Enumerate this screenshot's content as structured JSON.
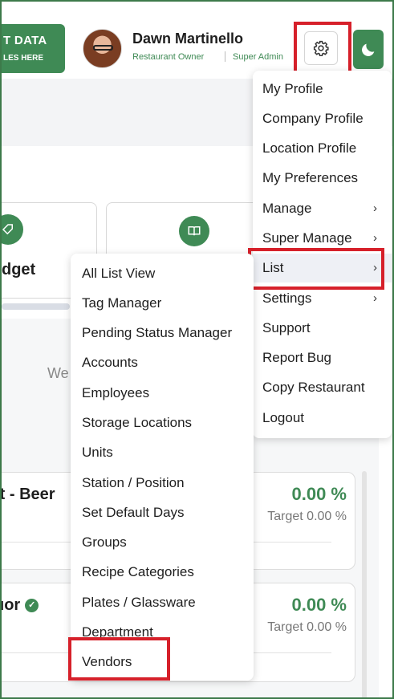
{
  "header": {
    "import_line1": "T DATA",
    "import_line2": "LES HERE",
    "user_name": "Dawn Martinello",
    "user_role": "Restaurant Owner",
    "user_role2": "Super Admin"
  },
  "background": {
    "budget_label": "dget",
    "we_text": "We",
    "rows": [
      {
        "title": "ft - Beer",
        "percent": "0.00 %",
        "target": "Target 0.00 %"
      },
      {
        "title": "uor",
        "percent": "0.00 %",
        "target": "Target 0.00 %"
      }
    ]
  },
  "main_menu": {
    "items": [
      {
        "label": "My Profile",
        "has_submenu": false
      },
      {
        "label": "Company Profile",
        "has_submenu": false
      },
      {
        "label": "Location Profile",
        "has_submenu": false
      },
      {
        "label": "My Preferences",
        "has_submenu": false
      },
      {
        "label": "Manage",
        "has_submenu": true
      },
      {
        "label": "Super Manage",
        "has_submenu": true
      },
      {
        "label": "List",
        "has_submenu": true,
        "active": true
      },
      {
        "label": "Settings",
        "has_submenu": true
      },
      {
        "label": "Support",
        "has_submenu": false
      },
      {
        "label": "Report Bug",
        "has_submenu": false
      },
      {
        "label": "Copy Restaurant",
        "has_submenu": false
      },
      {
        "label": "Logout",
        "has_submenu": false
      }
    ],
    "chevron": "›"
  },
  "list_submenu": {
    "items": [
      "All List View",
      "Tag Manager",
      "Pending Status Manager",
      "Accounts",
      "Employees",
      "Storage Locations",
      "Units",
      "Station / Position",
      "Set Default Days",
      "Groups",
      "Recipe Categories",
      "Plates / Glassware",
      "Department",
      "Vendors"
    ]
  },
  "colors": {
    "brand_green": "#3f8a55",
    "highlight_red": "#d6202a"
  },
  "icons": {
    "settings": "gear-icon",
    "theme": "moon-icon",
    "budget": "budget-tag-icon",
    "book": "book-icon",
    "verified": "check-icon"
  }
}
